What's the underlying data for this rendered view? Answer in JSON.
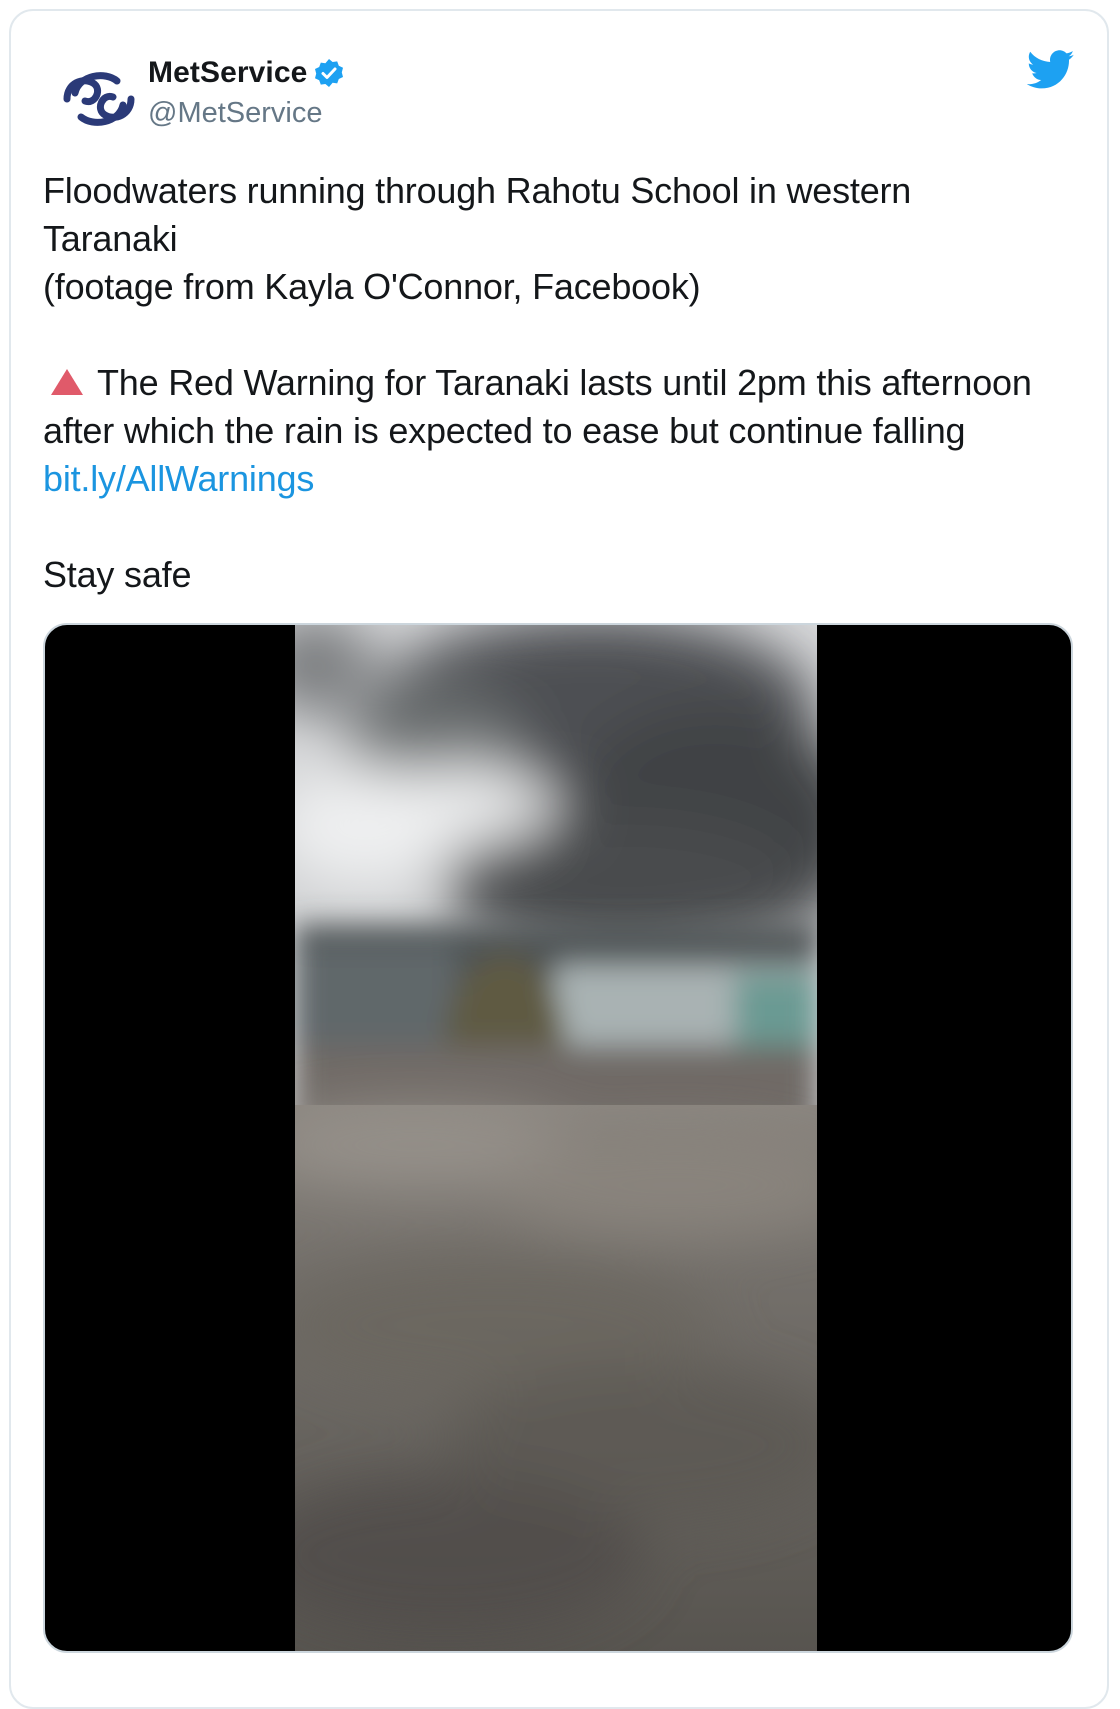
{
  "author": {
    "name": "MetService",
    "handle": "@MetService",
    "verified": true
  },
  "tweet": {
    "line1": "Floodwaters running through Rahotu School in western Taranaki",
    "line2": "(footage from Kayla O'Connor, Facebook)",
    "warning_text": "The Red Warning for Taranaki lasts until 2pm this afternoon after which the rain is expected to ease but continue falling",
    "link_text": "bit.ly/AllWarnings",
    "closing": "Stay safe"
  },
  "icons": {
    "avatar": "metservice-logo-icon",
    "verified": "verified-badge-icon",
    "platform": "twitter-bird-icon",
    "warning": "red-warning-triangle-icon"
  },
  "colors": {
    "link": "#1b95e0",
    "handle": "#657786",
    "brand_bird": "#1da1f2",
    "warning": "#e05a6a",
    "logo": "#2b3a78"
  }
}
